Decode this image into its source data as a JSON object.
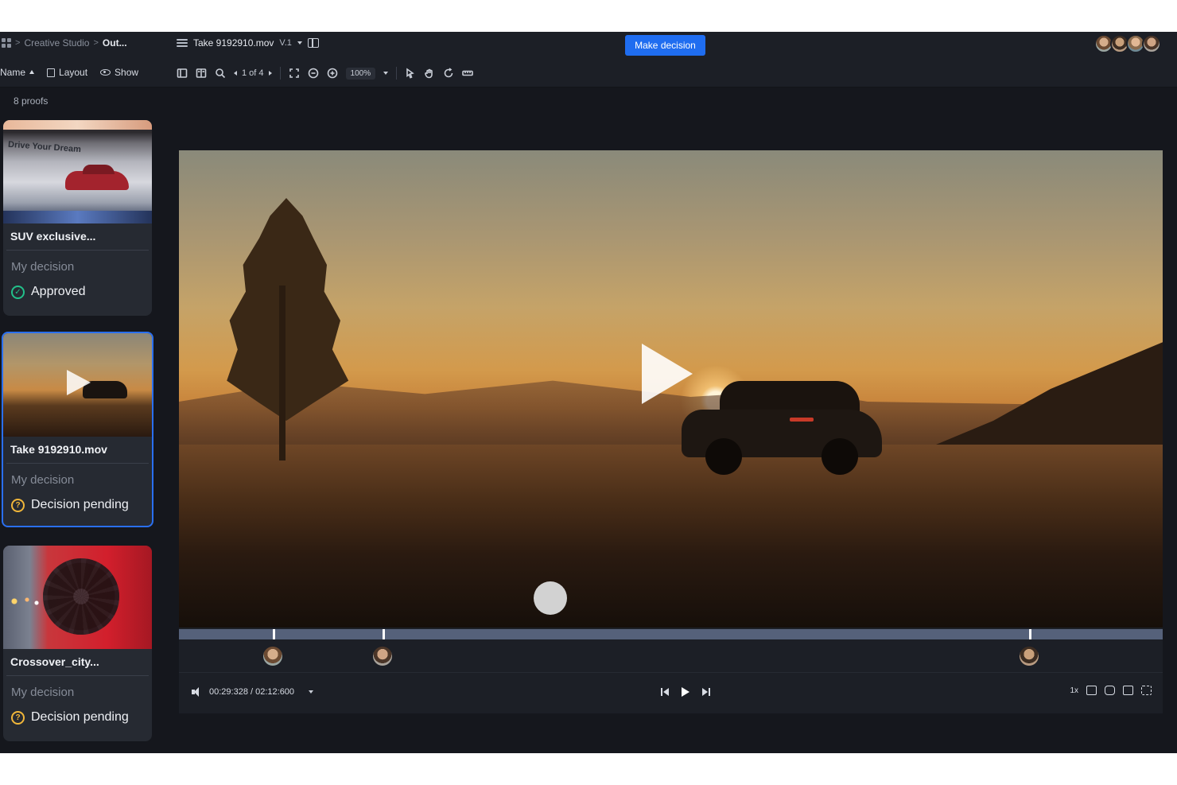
{
  "breadcrumb": {
    "workspace": "Creative Studio",
    "folder": "Out..."
  },
  "file": {
    "title": "Take 9192910.mov",
    "version": "V.1"
  },
  "header": {
    "make_decision_label": "Make decision"
  },
  "toolbar": {
    "sort_label": "Name",
    "layout_label": "Layout",
    "show_label": "Show",
    "page_indicator": "1 of 4",
    "zoom": "100%"
  },
  "sidebar": {
    "proof_count": "8 proofs",
    "proofs": [
      {
        "name": "SUV exclusive...",
        "decision_label": "My decision",
        "status": "Approved",
        "status_type": "approved",
        "thumb_text": "Drive Your Dream",
        "selected": false
      },
      {
        "name": "Take 9192910.mov",
        "decision_label": "My decision",
        "status": "Decision pending",
        "status_type": "pending",
        "selected": true
      },
      {
        "name": "Crossover_city...",
        "decision_label": "My decision",
        "status": "Decision pending",
        "status_type": "pending",
        "selected": false
      }
    ]
  },
  "player": {
    "time": "00:29:328 / 02:12:600",
    "speed": "1x"
  },
  "colors": {
    "accent": "#1f6df0",
    "approved": "#22c08a",
    "pending": "#f0b63a",
    "selected_border": "#2a6ff0"
  }
}
